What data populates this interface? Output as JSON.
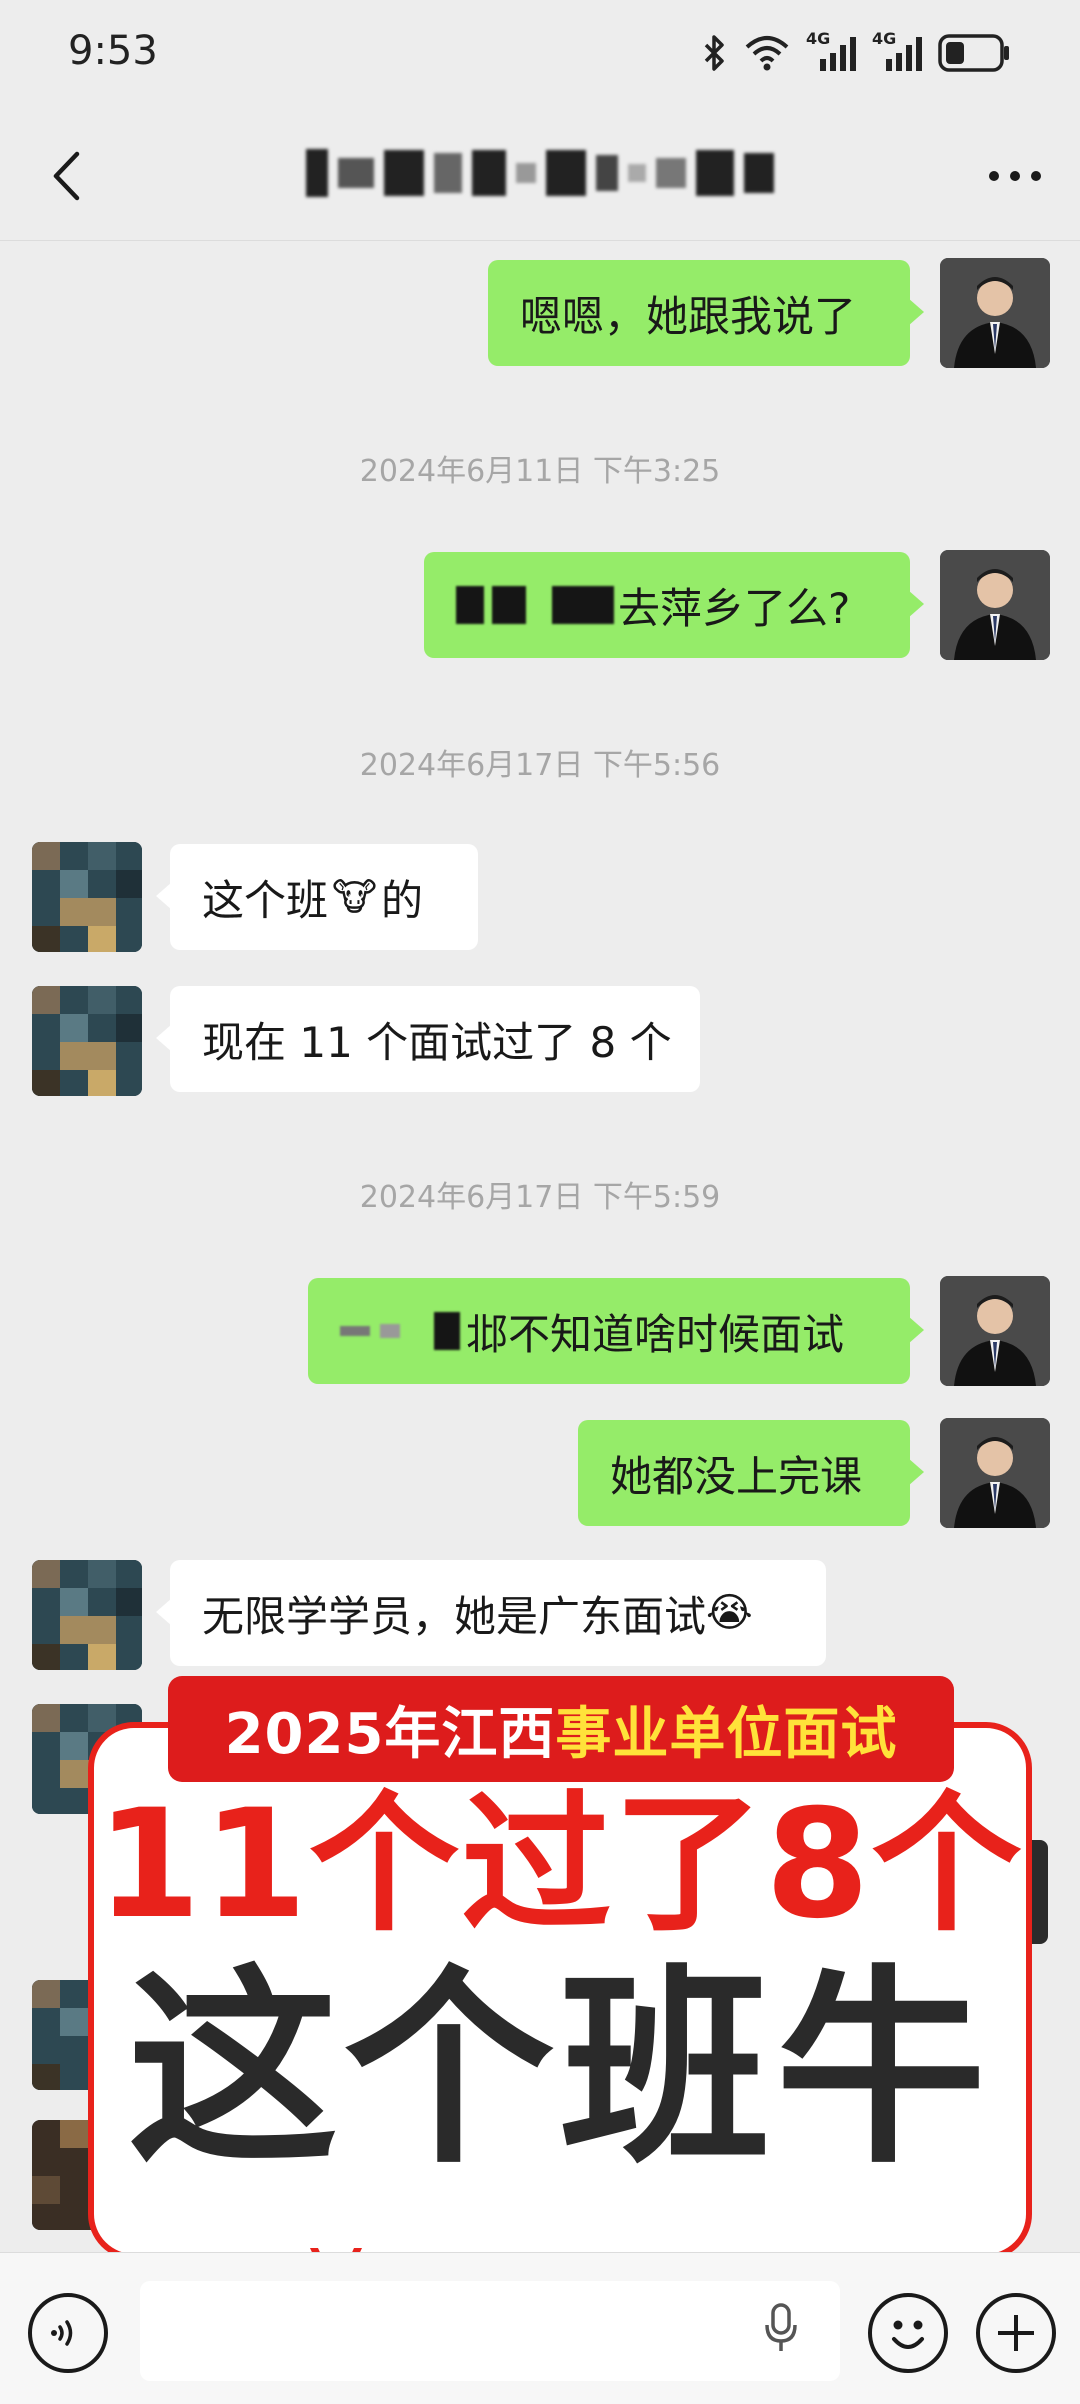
{
  "status_bar": {
    "time": "9:53",
    "network_1": "4G",
    "network_2": "4G",
    "battery_level_fraction": 0.35
  },
  "header": {
    "contact_name": "",
    "contact_name_redacted": true
  },
  "messages": [
    {
      "side": "out",
      "text": "嗯嗯，她跟我说了"
    },
    {
      "side": "time",
      "text": "2024年6月11日 下午3:25"
    },
    {
      "side": "out",
      "text": "去萍乡了么?",
      "redacted_prefix": true
    },
    {
      "side": "time",
      "text": "2024年6月17日 下午5:56"
    },
    {
      "side": "in",
      "text_before_emoji": "这个班",
      "emoji": "🐮",
      "text_after_emoji": " 的"
    },
    {
      "side": "in",
      "text": "现在 11 个面试过了 8 个"
    },
    {
      "side": "time",
      "text": "2024年6月17日 下午5:59"
    },
    {
      "side": "out",
      "text": "邶不知道啥时候面试",
      "redacted_prefix": true
    },
    {
      "side": "out",
      "text": "她都没上完课"
    },
    {
      "side": "in",
      "text": "无限学学员，她是广东面试",
      "emoji": "😭"
    }
  ],
  "overlay": {
    "banner_plain": "2025年江西",
    "banner_accent": "事业单位面试",
    "headline_1": "11个过了8个",
    "headline_2": "这个班牛"
  },
  "input_bar": {
    "placeholder": ""
  }
}
